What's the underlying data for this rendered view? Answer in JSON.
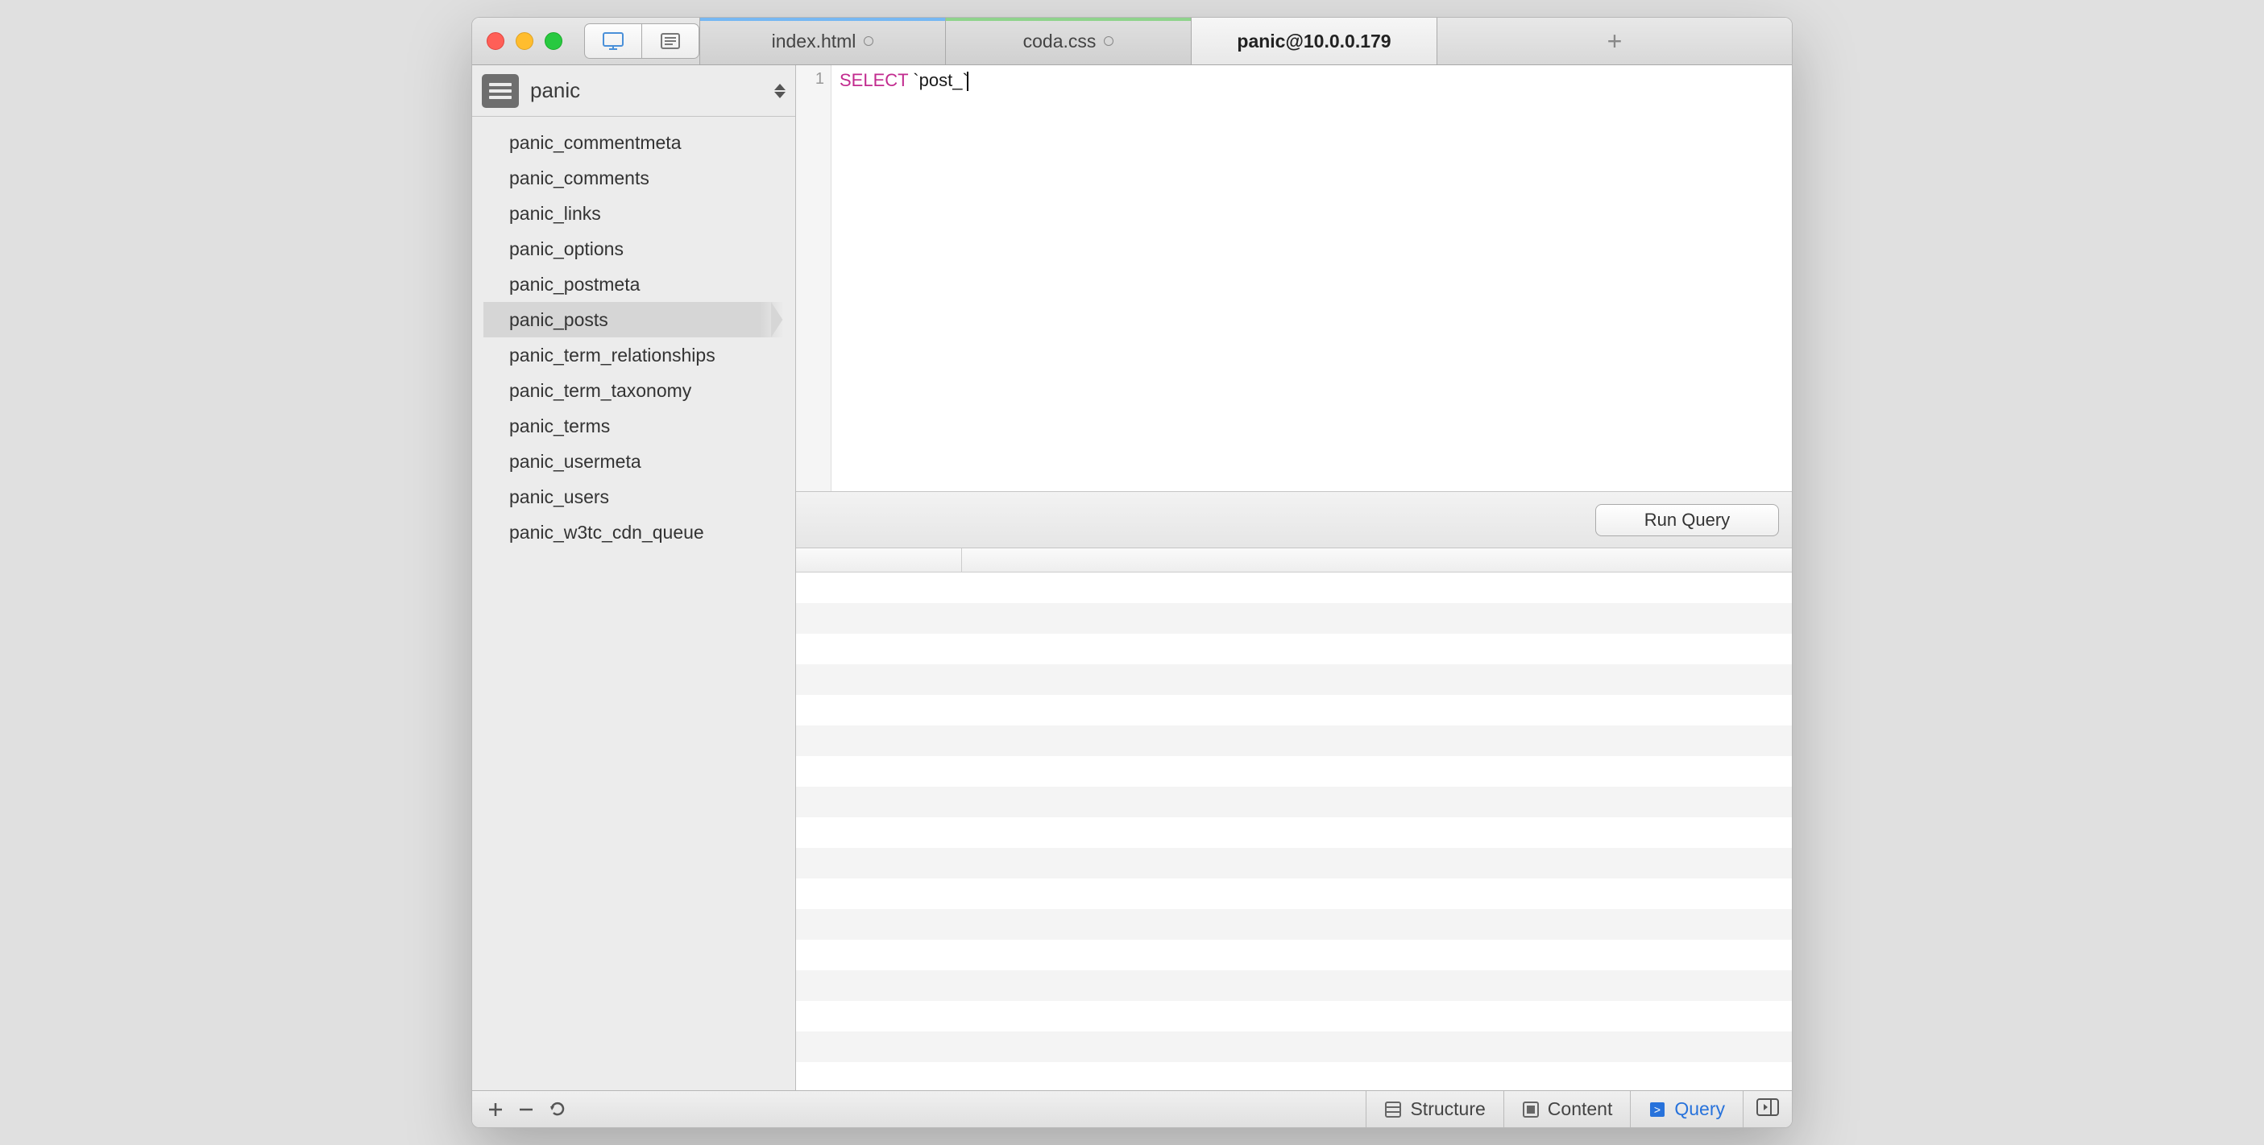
{
  "tabs": [
    {
      "label": "index.html",
      "modified": true,
      "color": "blue"
    },
    {
      "label": "coda.css",
      "modified": true,
      "color": "green"
    },
    {
      "label": "panic@10.0.0.179",
      "modified": false,
      "active": true
    }
  ],
  "sidebar": {
    "database": "panic",
    "tables": [
      "panic_commentmeta",
      "panic_comments",
      "panic_links",
      "panic_options",
      "panic_postmeta",
      "panic_posts",
      "panic_term_relationships",
      "panic_term_taxonomy",
      "panic_terms",
      "panic_usermeta",
      "panic_users",
      "panic_w3tc_cdn_queue"
    ],
    "selected_index": 5
  },
  "editor": {
    "line_number": "1",
    "keyword": "SELECT",
    "rest": " `post_`"
  },
  "run_button": "Run Query",
  "footer": {
    "tabs": {
      "structure": "Structure",
      "content": "Content",
      "query": "Query"
    },
    "active_tab": "query"
  }
}
